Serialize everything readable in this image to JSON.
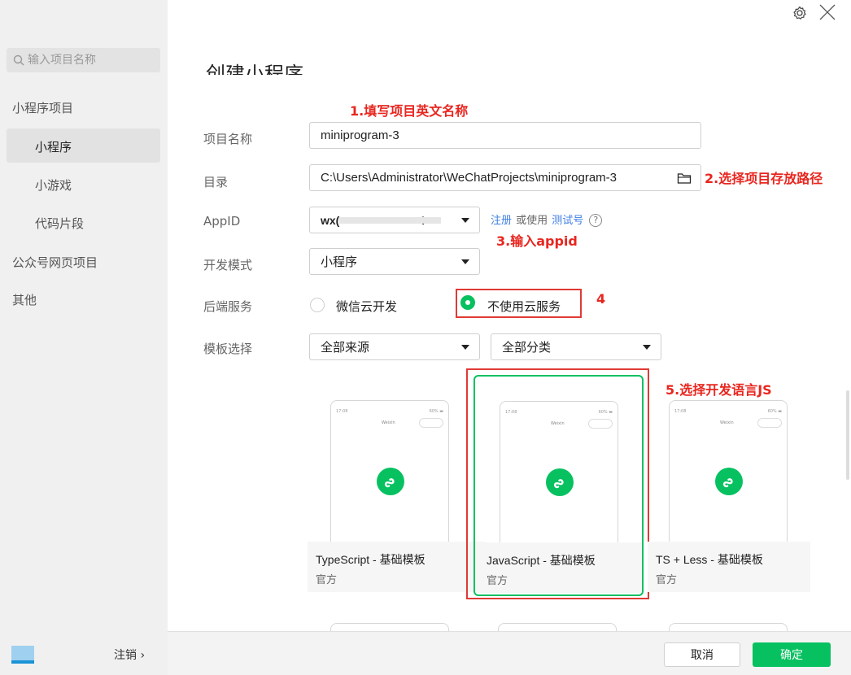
{
  "sidebar": {
    "search_placeholder": "输入项目名称",
    "groups": [
      {
        "label": "小程序项目"
      },
      {
        "label": "公众号网页项目"
      },
      {
        "label": "其他"
      }
    ],
    "items": [
      {
        "label": "小程序",
        "active": true
      },
      {
        "label": "小游戏"
      },
      {
        "label": "代码片段"
      }
    ],
    "logout_label": "注销 ›"
  },
  "header": {
    "title": "创建小程序",
    "settings_icon": "gear-icon",
    "close_icon": "close-icon"
  },
  "form": {
    "project_name_label": "项目名称",
    "project_name_value": "miniprogram-3",
    "directory_label": "目录",
    "directory_value": "C:\\Users\\Administrator\\WeChatProjects\\miniprogram-3",
    "appid_label": "AppID",
    "appid_value": "wx(                         4",
    "appid_register": "注册",
    "appid_or_use": "或使用",
    "appid_test": "测试号",
    "dev_mode_label": "开发模式",
    "dev_mode_value": "小程序",
    "backend_label": "后端服务",
    "backend_options": [
      {
        "label": "微信云开发",
        "selected": false
      },
      {
        "label": "不使用云服务",
        "selected": true
      }
    ],
    "template_label": "模板选择",
    "source_value": "全部来源",
    "category_value": "全部分类"
  },
  "annotations": {
    "step1": "1.填写项目英文名称",
    "step2": "2.选择项目存放路径",
    "step3": "3.输入appid",
    "step4": "4",
    "step5": "5.选择开发语言JS",
    "color": "#e8261f"
  },
  "templates": [
    {
      "name": "TypeScript - 基础模板",
      "source": "官方",
      "selected": false
    },
    {
      "name": "JavaScript - 基础模板",
      "source": "官方",
      "selected": true
    },
    {
      "name": "TS + Less - 基础模板",
      "source": "官方",
      "selected": false
    }
  ],
  "phone_preview": {
    "time": "17:08",
    "battery": "60% ▬",
    "title": "Weixin"
  },
  "buttons": {
    "cancel": "取消",
    "confirm": "确定"
  },
  "colors": {
    "accent": "#07c160",
    "link": "#3d7ee5"
  }
}
